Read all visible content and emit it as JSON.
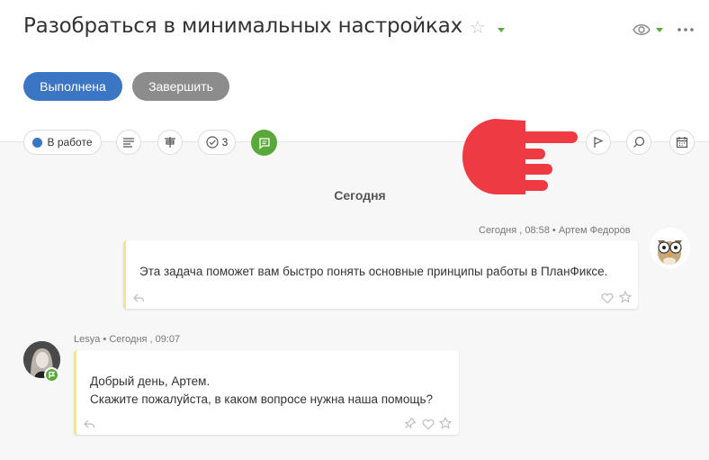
{
  "task": {
    "title": "Разобраться в минимальных настройках"
  },
  "actions": {
    "done_label": "Выполнена",
    "finish_label": "Завершить"
  },
  "toolbar": {
    "status_label": "В работе",
    "checklist_count": "3"
  },
  "feed": {
    "day_label": "Сегодня",
    "messages": [
      {
        "meta": "Сегодня , 08:58 • Артем Федоров",
        "text": "Эта задача поможет вам быстро понять основные принципы работы в ПланФиксе."
      },
      {
        "meta": "Lesya • Сегодня , 09:07",
        "line1": "Добрый день, Артем.",
        "line2": "Скажите пожалуйста, в каком вопросе нужна наша помощь?"
      }
    ]
  },
  "colors": {
    "primary": "#3a76c4",
    "accent_green": "#5aa83a",
    "secondary_button": "#8c8c8c",
    "pointer_hand": "#ee3a43",
    "message_border": "#f2e58d"
  },
  "icons": [
    "star-icon",
    "eye-icon",
    "more-icon",
    "description-icon",
    "fields-icon",
    "checklist-icon",
    "comment-icon",
    "flag-icon",
    "search-icon",
    "calendar-icon",
    "reply-icon",
    "like-icon",
    "pin-icon",
    "pointer-hand-icon"
  ]
}
